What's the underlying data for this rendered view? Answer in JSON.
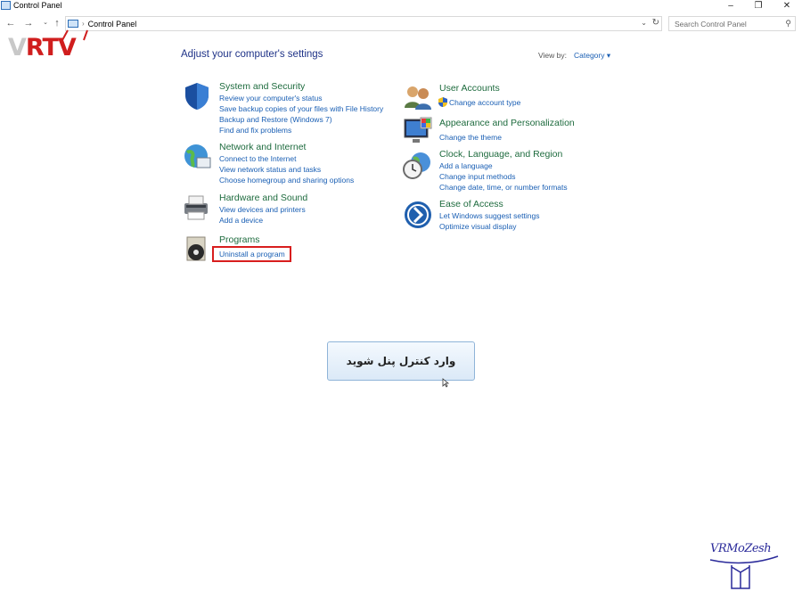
{
  "window": {
    "title": "Control Panel"
  },
  "address": {
    "path": "Control Panel",
    "separator": "›"
  },
  "search": {
    "placeholder": "Search Control Panel"
  },
  "logo": {
    "v": "V",
    "r": "R",
    "tv": "TV"
  },
  "page": {
    "heading": "Adjust your computer's settings",
    "view_by_label": "View by:",
    "view_by_value": "Category ▾"
  },
  "categories": [
    {
      "title": "System and Security",
      "icon": "shield-icon",
      "links": [
        "Review your computer's status",
        "Save backup copies of your files with File History",
        "Backup and Restore (Windows 7)",
        "Find and fix problems"
      ]
    },
    {
      "title": "Network and Internet",
      "icon": "network-globe-icon",
      "links": [
        "Connect to the Internet",
        "View network status and tasks",
        "Choose homegroup and sharing options"
      ]
    },
    {
      "title": "Hardware and Sound",
      "icon": "printer-icon",
      "links": [
        "View devices and printers",
        "Add a device"
      ]
    },
    {
      "title": "Programs",
      "icon": "programs-disc-icon",
      "links": [
        "Uninstall a program"
      ]
    },
    {
      "title": "User Accounts",
      "icon": "users-icon",
      "links": [
        "Change account type"
      ]
    },
    {
      "title": "Appearance and Personalization",
      "icon": "monitor-palette-icon",
      "links": [
        "Change the theme"
      ]
    },
    {
      "title": "Clock, Language, and Region",
      "icon": "clock-globe-icon",
      "links": [
        "Add a language",
        "Change input methods",
        "Change date, time, or number formats"
      ]
    },
    {
      "title": "Ease of Access",
      "icon": "ease-of-access-icon",
      "links": [
        "Let Windows suggest settings",
        "Optimize visual display"
      ]
    }
  ],
  "tooltip": {
    "text": "وارد کنترل پنل شوید"
  },
  "watermark": {
    "text": "VRMoZesh"
  }
}
